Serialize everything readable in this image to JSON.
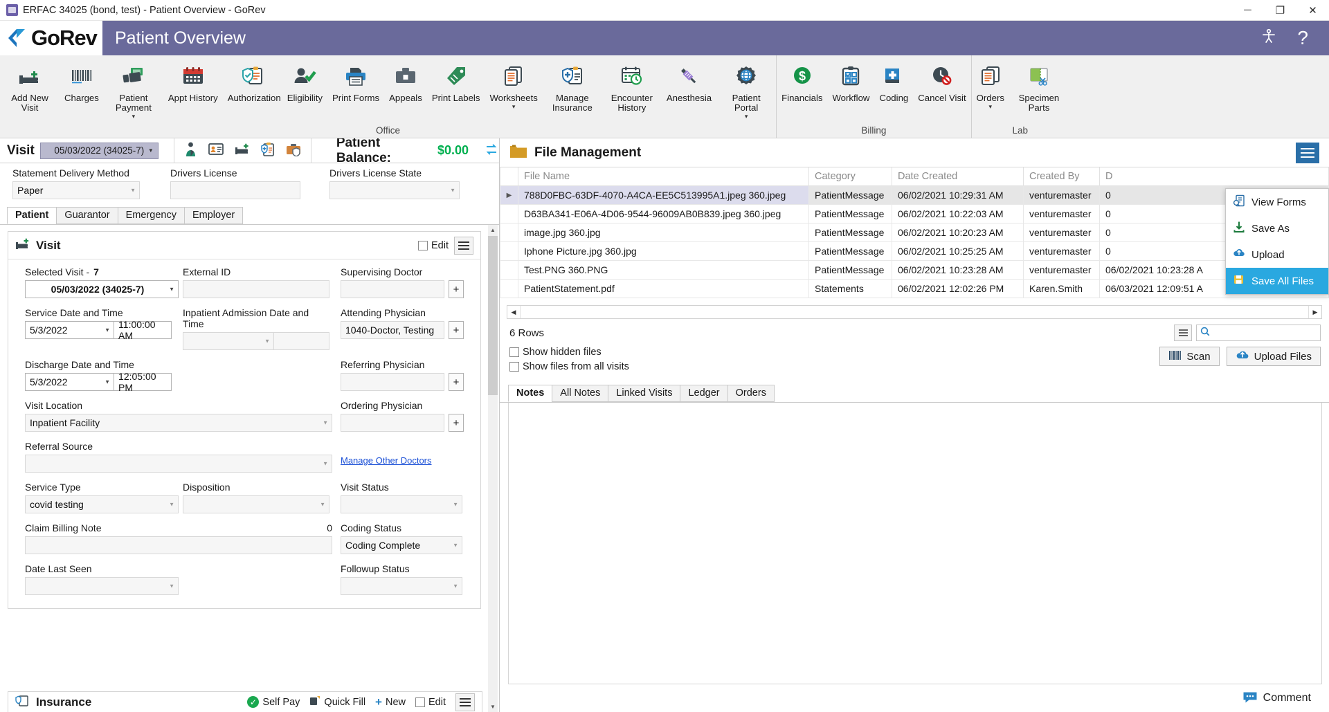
{
  "window": {
    "title": "ERFAC 34025 (bond, test) - Patient Overview - GoRev",
    "minimize": "─",
    "maximize": "❐",
    "close": "✕"
  },
  "header": {
    "brand": "GoRev",
    "title": "Patient Overview",
    "help": "?"
  },
  "ribbon": {
    "groups": [
      {
        "label": "Office",
        "buttons": [
          {
            "label": "Add New Visit",
            "icon": "add-new-visit-icon",
            "caret": false
          },
          {
            "label": "Charges",
            "icon": "charges-barcode-icon",
            "caret": false
          },
          {
            "label": "Patient Payment",
            "icon": "patient-payment-icon",
            "caret": true
          },
          {
            "label": "Appt History",
            "icon": "calendar-icon",
            "caret": false
          },
          {
            "label": "Authorization",
            "icon": "authorization-shield-icon",
            "caret": false
          },
          {
            "label": "Eligibility",
            "icon": "eligibility-person-check-icon",
            "caret": false
          },
          {
            "label": "Print Forms",
            "icon": "printer-icon",
            "caret": false
          },
          {
            "label": "Appeals",
            "icon": "briefcase-icon",
            "caret": false
          },
          {
            "label": "Print Labels",
            "icon": "tag-icon",
            "caret": false
          },
          {
            "label": "Worksheets",
            "icon": "worksheets-icon",
            "caret": true
          },
          {
            "label": "Manage Insurance",
            "icon": "manage-insurance-icon",
            "caret": false
          },
          {
            "label": "Encounter History",
            "icon": "encounter-history-icon",
            "caret": false
          },
          {
            "label": "Anesthesia",
            "icon": "syringe-icon",
            "caret": false
          },
          {
            "label": "Patient Portal",
            "icon": "patient-portal-globe-icon",
            "caret": true
          }
        ]
      },
      {
        "label": "Billing",
        "buttons": [
          {
            "label": "Financials",
            "icon": "dollar-circle-icon",
            "caret": false
          },
          {
            "label": "Workflow",
            "icon": "workflow-clipboard-icon",
            "caret": false
          },
          {
            "label": "Coding",
            "icon": "coding-book-icon",
            "caret": false
          },
          {
            "label": "Cancel Visit",
            "icon": "cancel-visit-icon",
            "caret": false
          }
        ]
      },
      {
        "label": "Lab",
        "buttons": [
          {
            "label": "Orders",
            "icon": "orders-documents-icon",
            "caret": true
          },
          {
            "label": "Specimen Parts",
            "icon": "specimen-parts-icon",
            "caret": false
          }
        ]
      }
    ]
  },
  "visit_bar": {
    "label": "Visit",
    "selected": "05/03/2022 (34025-7)",
    "icons": [
      "patient-icon",
      "id-card-icon",
      "bed-icon",
      "insurance-clipboard-icon",
      "briefcase-shield-icon"
    ],
    "balance_label": "Patient Balance:",
    "balance_value": "$0.00",
    "balance_color": "#00b050",
    "refresh_icon": "refresh-icon"
  },
  "patient_top": {
    "statement_delivery_label": "Statement Delivery Method",
    "statement_delivery_value": "Paper",
    "drivers_license_label": "Drivers License",
    "drivers_license_value": "",
    "drivers_license_state_label": "Drivers License State",
    "drivers_license_state_value": ""
  },
  "patient_tabs": [
    {
      "label": "Patient",
      "active": true
    },
    {
      "label": "Guarantor",
      "active": false
    },
    {
      "label": "Emergency",
      "active": false
    },
    {
      "label": "Employer",
      "active": false
    }
  ],
  "visit_card": {
    "title": "Visit",
    "icon": "bed-plus-icon",
    "edit_label": "Edit",
    "menu_icon": "hamburger-icon",
    "fields": {
      "selected_visit_label": "Selected Visit -",
      "selected_visit_count": "7",
      "selected_visit_value": "05/03/2022 (34025-7)",
      "external_id_label": "External ID",
      "external_id_value": "",
      "supervising_doctor_label": "Supervising Doctor",
      "supervising_doctor_value": "",
      "service_date_label": "Service Date and Time",
      "service_date_value": "5/3/2022",
      "service_time_value": "11:00:00 AM",
      "inpatient_admission_label": "Inpatient Admission Date and Time",
      "inpatient_admission_date": "",
      "inpatient_admission_time": "",
      "attending_physician_label": "Attending Physician",
      "attending_physician_value": "1040-Doctor, Testing",
      "discharge_label": "Discharge Date and Time",
      "discharge_date_value": "5/3/2022",
      "discharge_time_value": "12:05:00 PM",
      "referring_physician_label": "Referring Physician",
      "referring_physician_value": "",
      "visit_location_label": "Visit Location",
      "visit_location_value": "Inpatient Facility",
      "ordering_physician_label": "Ordering Physician",
      "ordering_physician_value": "",
      "manage_other_doctors_link": "Manage Other Doctors",
      "referral_source_label": "Referral Source",
      "referral_source_value": "",
      "service_type_label": "Service Type",
      "service_type_value": "covid testing",
      "disposition_label": "Disposition",
      "disposition_value": "",
      "visit_status_label": "Visit Status",
      "visit_status_value": "",
      "claim_billing_note_label": "Claim Billing Note",
      "claim_billing_note_count": "0",
      "claim_billing_note_value": "",
      "coding_status_label": "Coding Status",
      "coding_status_value": "Coding Complete",
      "date_last_seen_label": "Date Last Seen",
      "date_last_seen_value": "",
      "followup_status_label": "Followup Status",
      "followup_status_value": "",
      "plus_button": "+"
    }
  },
  "insurance_section": {
    "title": "Insurance",
    "icon": "insurance-icon",
    "self_pay": "Self Pay",
    "quick_fill": "Quick Fill",
    "new": "New",
    "edit": "Edit",
    "menu_icon": "hamburger-icon"
  },
  "file_management": {
    "title": "File Management",
    "folder_icon": "folder-icon",
    "menu_icon": "hamburger-icon",
    "columns": [
      "File Name",
      "Category",
      "Date Created",
      "Created By",
      "D"
    ],
    "rows": [
      {
        "selected": true,
        "file_name": "788D0FBC-63DF-4070-A4CA-EE5C513995A1.jpeg 360.jpeg",
        "category": "PatientMessage",
        "date_created": "06/02/2021 10:29:31 AM",
        "created_by": "venturemaster",
        "extra": "0"
      },
      {
        "selected": false,
        "file_name": "D63BA341-E06A-4D06-9544-96009AB0B839.jpeg 360.jpeg",
        "category": "PatientMessage",
        "date_created": "06/02/2021 10:22:03 AM",
        "created_by": "venturemaster",
        "extra": "0"
      },
      {
        "selected": false,
        "file_name": "image.jpg 360.jpg",
        "category": "PatientMessage",
        "date_created": "06/02/2021 10:20:23 AM",
        "created_by": "venturemaster",
        "extra": "0"
      },
      {
        "selected": false,
        "file_name": "Iphone Picture.jpg 360.jpg",
        "category": "PatientMessage",
        "date_created": "06/02/2021 10:25:25 AM",
        "created_by": "venturemaster",
        "extra": "0"
      },
      {
        "selected": false,
        "file_name": "Test.PNG 360.PNG",
        "category": "PatientMessage",
        "date_created": "06/02/2021 10:23:28 AM",
        "created_by": "venturemaster",
        "extra": "06/02/2021 10:23:28 A"
      },
      {
        "selected": false,
        "file_name": "PatientStatement.pdf",
        "category": "Statements",
        "date_created": "06/02/2021 12:02:26 PM",
        "created_by": "Karen.Smith",
        "extra": "06/03/2021 12:09:51 A"
      }
    ],
    "context_menu": [
      {
        "label": "View Forms",
        "icon": "view-forms-icon",
        "highlighted": false
      },
      {
        "label": "Save As",
        "icon": "save-as-icon",
        "highlighted": false
      },
      {
        "label": "Upload",
        "icon": "upload-cloud-icon",
        "highlighted": false
      },
      {
        "label": "Save All Files",
        "icon": "save-all-files-icon",
        "highlighted": true
      }
    ],
    "row_count": "6 Rows",
    "grid_menu_icon": "grid-menu-icon",
    "search_icon": "search-icon",
    "search_value": "",
    "show_hidden_files": "Show hidden files",
    "show_files_all_visits": "Show files from all visits",
    "scan_button": "Scan",
    "scan_icon": "scan-icon",
    "upload_files_button": "Upload Files",
    "upload_files_icon": "upload-cloud-icon"
  },
  "notes_tabs": [
    {
      "label": "Notes",
      "active": true
    },
    {
      "label": "All Notes",
      "active": false
    },
    {
      "label": "Linked Visits",
      "active": false
    },
    {
      "label": "Ledger",
      "active": false
    },
    {
      "label": "Orders",
      "active": false
    }
  ],
  "footer": {
    "comment_label": "Comment",
    "comment_icon": "comment-icon"
  }
}
